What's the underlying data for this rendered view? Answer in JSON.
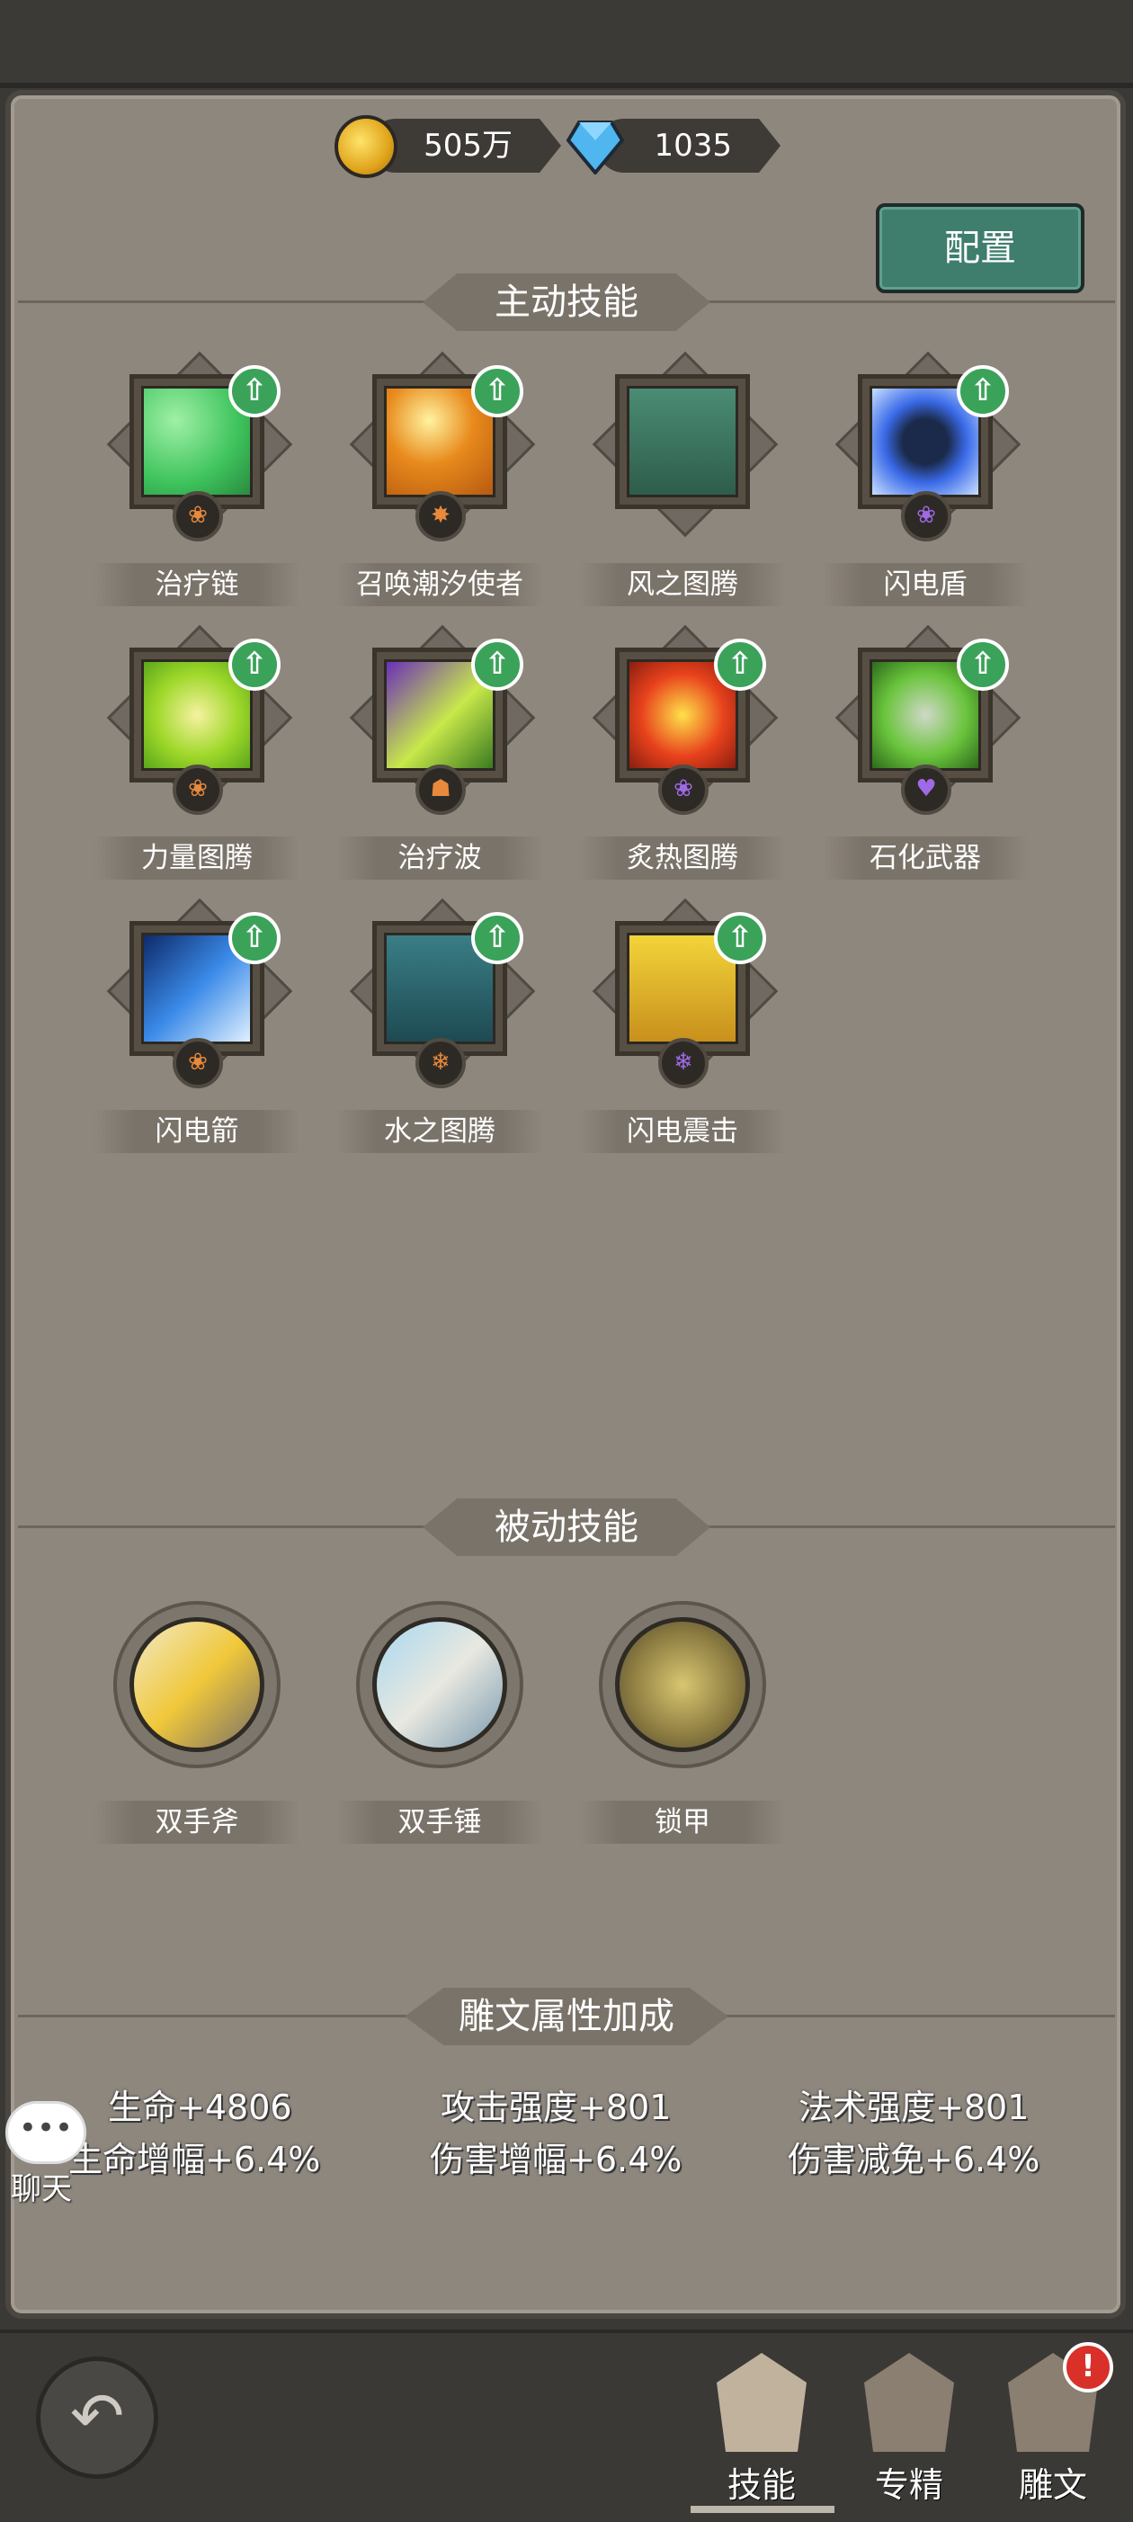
{
  "currency": {
    "gold": "505万",
    "gems": "1035"
  },
  "buttons": {
    "config": "配置"
  },
  "sections": {
    "active": "主动技能",
    "passive": "被动技能",
    "rune_bonus": "雕文属性加成"
  },
  "active_skills": [
    {
      "name": "治疗链",
      "badge": "❀"
    },
    {
      "name": "召唤潮汐使者",
      "badge": "✸"
    },
    {
      "name": "风之图腾",
      "badge": ""
    },
    {
      "name": "闪电盾",
      "badge": "❀"
    },
    {
      "name": "力量图腾",
      "badge": "❀"
    },
    {
      "name": "治疗波",
      "badge": "☗"
    },
    {
      "name": "炙热图腾",
      "badge": "❀"
    },
    {
      "name": "石化武器",
      "badge": "♥"
    },
    {
      "name": "闪电箭",
      "badge": "❀"
    },
    {
      "name": "水之图腾",
      "badge": "❄"
    },
    {
      "name": "闪电震击",
      "badge": "❄"
    }
  ],
  "passive_skills": [
    {
      "name": "双手斧"
    },
    {
      "name": "双手锤"
    },
    {
      "name": "锁甲"
    }
  ],
  "stats": {
    "hp": "生命+4806",
    "attack": "攻击强度+801",
    "spell": "法术强度+801",
    "hp_amp": "生命增幅+6.4%",
    "dmg_amp": "伤害增幅+6.4%",
    "dmg_reduce": "伤害减免+6.4%"
  },
  "chat": {
    "icon_text": "•••",
    "label": "聊天"
  },
  "tabs": {
    "skills": "技能",
    "mastery": "专精",
    "runes": "雕文"
  },
  "alert_mark": "!",
  "upgrade_glyph": "⇧",
  "back_glyph": "↶",
  "colors": {
    "panel": "#8e877e",
    "config_button": "#3f7d6d",
    "upgrade_badge": "#3ba25a",
    "alert": "#d9302a"
  }
}
